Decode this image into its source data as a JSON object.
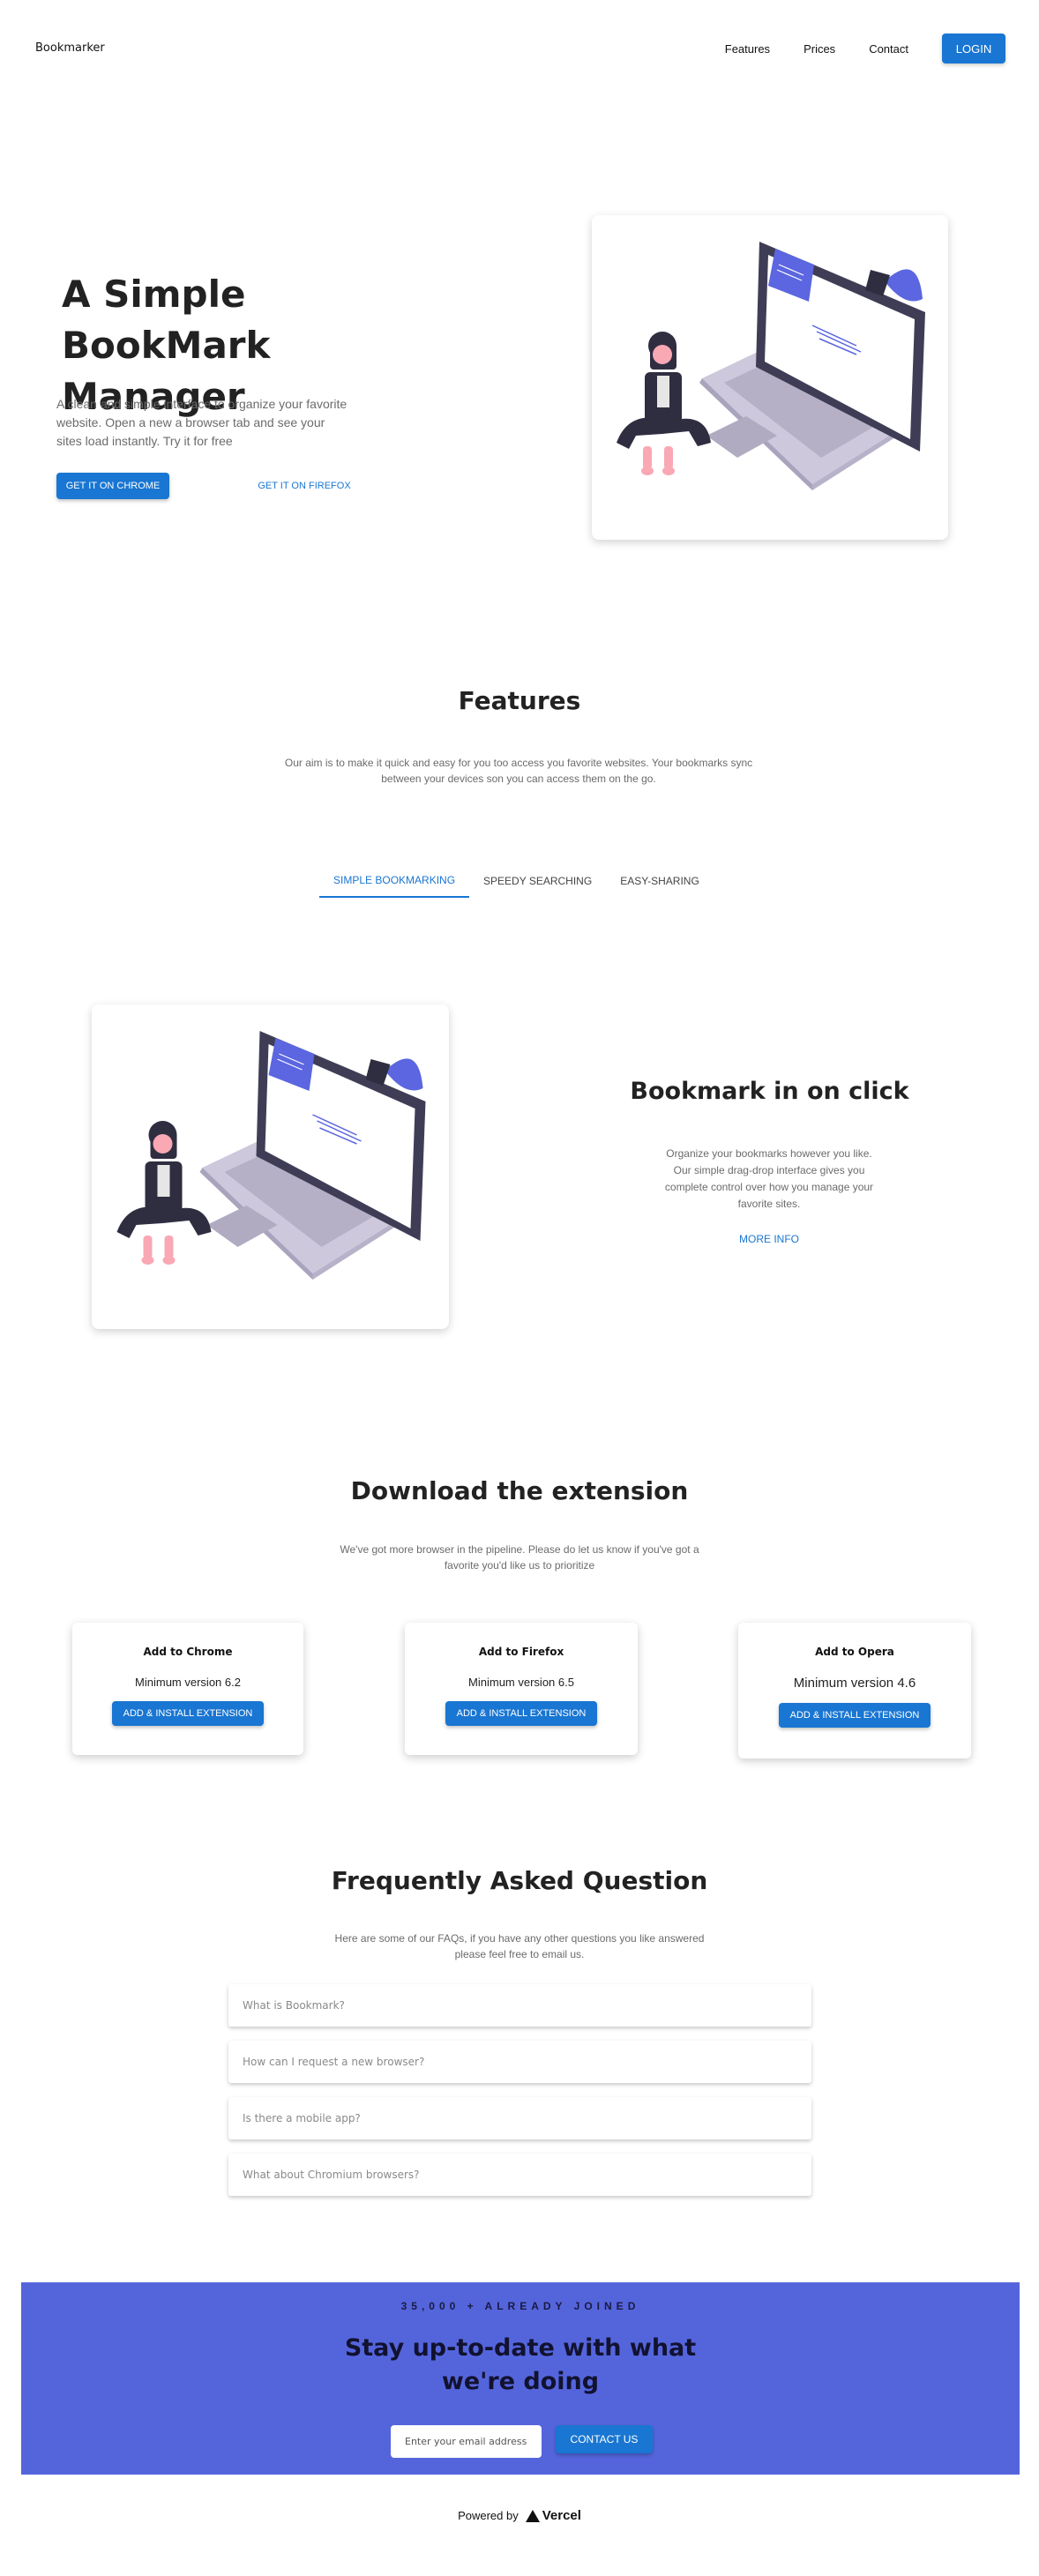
{
  "nav": {
    "logo": "Bookmarker",
    "links": [
      "Features",
      "Prices",
      "Contact"
    ],
    "login": "LOGIN"
  },
  "hero": {
    "title": "A Simple BookMark Manager",
    "description": "A clean and simple interface to organize your favorite website. Open a new a browser tab and see your sites load instantly. Try it for free",
    "chrome_button": "GET IT ON CHROME",
    "firefox_button": "GET IT ON FIREFOX"
  },
  "features": {
    "title": "Features",
    "description": "Our aim is to make it quick and easy for you too access you favorite websites. Your bookmarks sync between your devices son you can access them on the go.",
    "tabs": [
      "SIMPLE BOOKMARKING",
      "SPEEDY SEARCHING",
      "EASY-SHARING"
    ],
    "active_tab": "SIMPLE BOOKMARKING",
    "panel_title": "Bookmark in on click",
    "panel_description": "Organize your bookmarks however you like. Our simple drag-drop interface gives you complete control over how you manage your favorite sites.",
    "more_info": "MORE INFO"
  },
  "download": {
    "title": "Download the extension",
    "description": "We've got more browser in the pipeline. Please do let us know if you've got a favorite you'd like us to prioritize",
    "cards": [
      {
        "name": "Add to Chrome",
        "version": "Minimum version 6.2",
        "button": "ADD & INSTALL EXTENSION"
      },
      {
        "name": "Add to Firefox",
        "version": "Minimum version 6.5",
        "button": "ADD & INSTALL EXTENSION"
      },
      {
        "name": "Add to Opera",
        "version": "Minimum version 4.6",
        "button": "ADD & INSTALL EXTENSION"
      }
    ]
  },
  "faq": {
    "title": "Frequently Asked Question",
    "description": "Here are some of our FAQs, if you have any other questions you like answered please feel free to email us.",
    "items": [
      "What is Bookmark?",
      "How can I request a new browser?",
      "Is there a mobile app?",
      "What about Chromium browsers?"
    ]
  },
  "cta": {
    "kicker": "35,000 + ALREADY JOINED",
    "title": "Stay up-to-date with what we're doing",
    "email_placeholder": "Enter your email address",
    "button": "CONTACT US"
  },
  "footer": {
    "powered_by": "Powered by",
    "brand": "Vercel"
  },
  "colors": {
    "primary": "#1976d2",
    "cta_background": "#5465dc",
    "illustration_accent": "#5b66e0"
  }
}
